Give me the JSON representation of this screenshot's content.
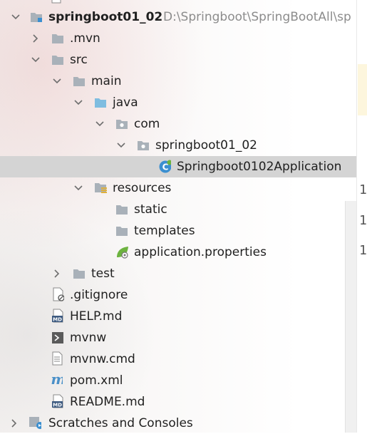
{
  "project": {
    "name": "springboot01_02",
    "path": "D:\\Springboot\\SpringBootAll\\sp"
  },
  "tree": {
    "mvn": ".mvn",
    "src": "src",
    "main": "main",
    "java": "java",
    "com": "com",
    "package": "springboot01_02",
    "app_class": "Springboot0102Application",
    "resources": "resources",
    "static": "static",
    "templates": "templates",
    "app_props": "application.properties",
    "test": "test",
    "gitignore": ".gitignore",
    "help": "HELP.md",
    "mvnw": "mvnw",
    "mvnw_cmd": "mvnw.cmd",
    "pom": "pom.xml",
    "readme": "README.md",
    "scratches": "Scratches and Consoles"
  },
  "icons": {
    "folder_color": "#a9b1b9",
    "source_folder_color": "#7fbde0",
    "class_color": "#3b8fd0",
    "spring_color": "#6db33f",
    "md_color": "#3d5a80"
  },
  "editor_gutter": [
    "1",
    "1",
    "1"
  ]
}
